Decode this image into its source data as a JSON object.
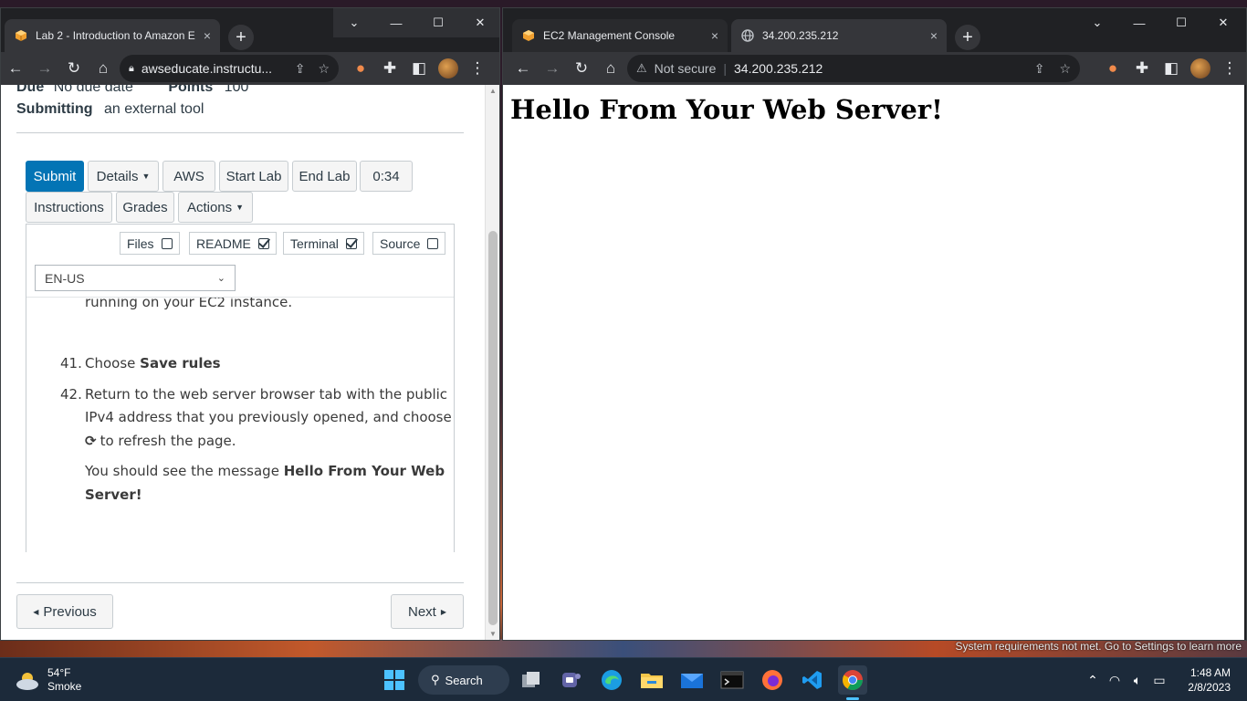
{
  "left_window": {
    "tab": {
      "title": "Lab 2 - Introduction to Amazon E",
      "close": "×"
    },
    "new_tab": "+",
    "address": "awseducate.instructu...",
    "page": {
      "due_label": "Due",
      "due_value": "No due date",
      "points_label": "Points",
      "points_value": "100",
      "submitting_label": "Submitting",
      "submitting_value": "an external tool",
      "buttons": {
        "submit": "Submit",
        "details": "Details",
        "aws": "AWS",
        "start_lab": "Start Lab",
        "end_lab": "End Lab",
        "timer": "0:34",
        "instructions": "Instructions",
        "grades": "Grades",
        "actions": "Actions"
      },
      "toggles": {
        "files": "Files",
        "files_checked": false,
        "readme": "README",
        "readme_checked": true,
        "terminal": "Terminal",
        "terminal_checked": true,
        "source": "Source",
        "source_checked": false
      },
      "language": "EN-US",
      "instructions": {
        "line_partial": "running on your EC2 instance.",
        "step41_num": "41.",
        "step41_pre": "Choose ",
        "step41_bold": "Save rules",
        "step42_num": "42.",
        "step42_line1": "Return to the web server browser tab with the public",
        "step42_line2": "IPv4 address that you previously opened, and choose",
        "step42_line3": "to refresh the page.",
        "msg_pre": "You should see the message ",
        "msg_bold1": "Hello From Your Web",
        "msg_bold2": "Server!"
      },
      "prev": "Previous",
      "next": "Next"
    }
  },
  "right_window": {
    "tabs": [
      {
        "title": "EC2 Management Console",
        "close": "×"
      },
      {
        "title": "34.200.235.212",
        "close": "×"
      }
    ],
    "new_tab": "+",
    "security": "Not secure",
    "address": "34.200.235.212",
    "heading": "Hello From Your Web Server!"
  },
  "desktop": {
    "notice": "System requirements not met. Go to Settings to learn more"
  },
  "taskbar": {
    "weather_temp": "54°F",
    "weather_desc": "Smoke",
    "search": "Search",
    "time": "1:48 AM",
    "date": "2/8/2023"
  },
  "colors": {
    "canvas_blue": "#0374b5",
    "chrome_dark": "#202124",
    "chrome_toolbar": "#35363a",
    "taskbar": "#1c2a3a"
  }
}
